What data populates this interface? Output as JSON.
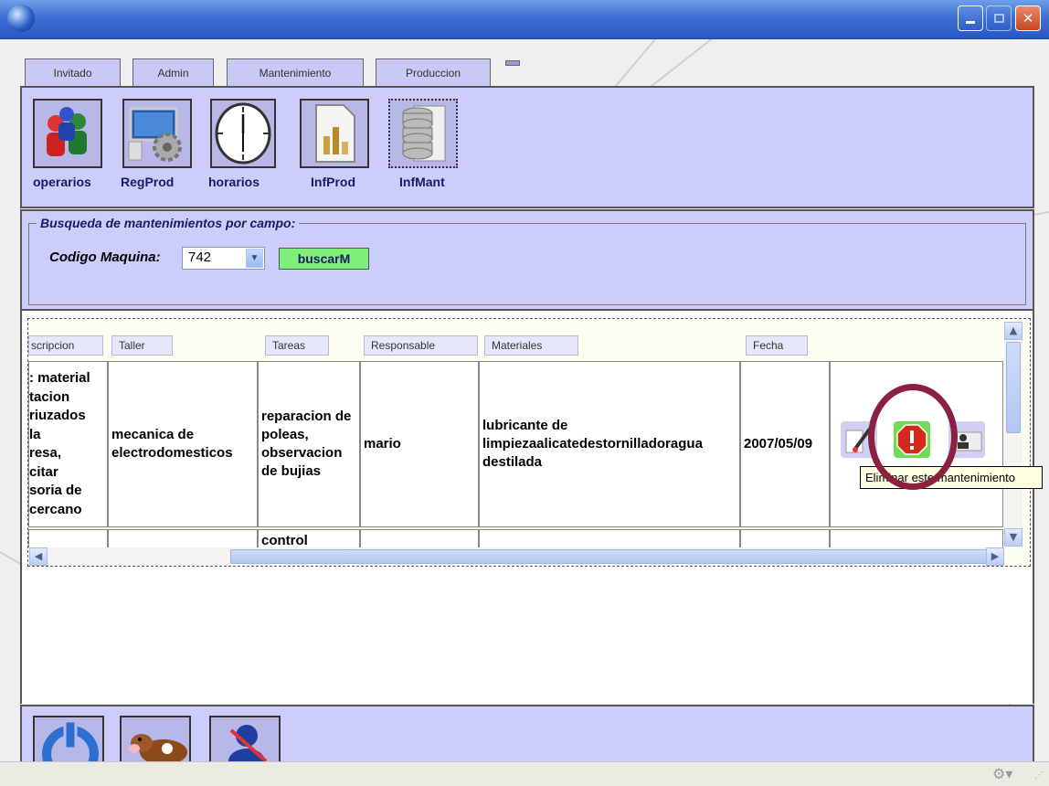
{
  "tabs": [
    "Invitado",
    "Admin",
    "Mantenimiento",
    "Produccion"
  ],
  "toolbar": {
    "items": [
      {
        "label": "operarios",
        "icon": "users-icon"
      },
      {
        "label": "RegProd",
        "icon": "computer-gear-icon"
      },
      {
        "label": "horarios",
        "icon": "clock-icon"
      },
      {
        "label": "InfProd",
        "icon": "report-chart-icon"
      },
      {
        "label": "InfMant",
        "icon": "database-report-icon"
      }
    ]
  },
  "search": {
    "legend": "Busqueda de mantenimientos por campo:",
    "field_label": "Codigo Maquina:",
    "selected_value": "742",
    "button_label": "buscarM"
  },
  "table": {
    "headers": [
      "scripcion",
      "Taller",
      "Tareas",
      "Responsable",
      "Materiales",
      "Fecha"
    ],
    "row1": {
      "descripcion": ": material\ntacion\nriuzados\nla\nresa,\ncitar\nsoria de\ncercano",
      "taller": "mecanica de electrodomesticos",
      "tareas": "reparacion de poleas, observacion de bujias",
      "responsable": "mario",
      "materiales": "lubricante de limpiezaalicatedestornilladoragua destilada",
      "fecha": "2007/05/09"
    },
    "row2": {
      "tareas": "control"
    },
    "actions": [
      {
        "icon": "edit-icon"
      },
      {
        "icon": "stop-delete-icon"
      },
      {
        "icon": "person-card-icon"
      }
    ],
    "tooltip": "Eliminar este mantenimiento"
  },
  "bottom_icons": [
    "power-icon",
    "cow-icon",
    "user-tools-icon"
  ],
  "colors": {
    "panel": "#cccdfa",
    "button_green": "#7ef07a",
    "highlight_circle": "#8c2043",
    "delete_red": "#d22a1c"
  }
}
